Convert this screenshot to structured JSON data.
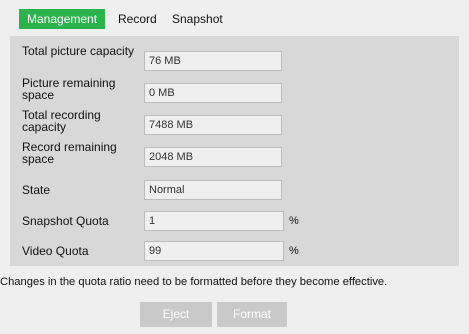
{
  "tabs": {
    "management": "Management",
    "record": "Record",
    "snapshot": "Snapshot"
  },
  "fields": {
    "total_picture_capacity": {
      "label": "Total picture capacity",
      "value": "76 MB"
    },
    "picture_remaining_space": {
      "label": "Picture remaining space",
      "value": "0 MB"
    },
    "total_recording_capacity": {
      "label": "Total recording capacity",
      "value": "7488 MB"
    },
    "record_remaining_space": {
      "label": "Record remaining space",
      "value": "2048 MB"
    },
    "state": {
      "label": "State",
      "value": "Normal"
    },
    "snapshot_quota": {
      "label": "Snapshot Quota",
      "value": "1",
      "unit": "%"
    },
    "video_quota": {
      "label": "Video Quota",
      "value": "99",
      "unit": "%"
    }
  },
  "note": "Changes in the quota ratio need to be formatted before they become effective.",
  "buttons": {
    "eject": "Eject",
    "format": "Format"
  },
  "colors": {
    "active_tab": "#2bb24c",
    "panel": "#d8d8d8",
    "button": "#c9c9c9"
  }
}
